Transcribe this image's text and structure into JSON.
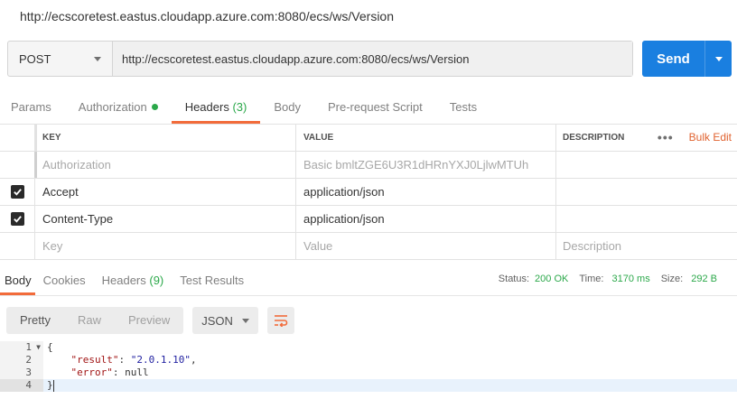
{
  "window": {
    "title": "http://ecscoretest.eastus.cloudapp.azure.com:8080/ecs/ws/Version"
  },
  "request": {
    "method": "POST",
    "url": "http://ecscoretest.eastus.cloudapp.azure.com:8080/ecs/ws/Version",
    "send_label": "Send"
  },
  "request_tabs": {
    "params": "Params",
    "authorization": "Authorization",
    "headers": "Headers",
    "headers_count": "(3)",
    "body": "Body",
    "prerequest": "Pre-request Script",
    "tests": "Tests",
    "active": "Headers"
  },
  "headers_table": {
    "columns": {
      "key": "KEY",
      "value": "VALUE",
      "description": "DESCRIPTION"
    },
    "bulk_edit": "Bulk Edit",
    "rows": [
      {
        "key": "Authorization",
        "value": "Basic bmltZGE6U3R1dHRnYXJ0LjlwMTUh",
        "checked": false
      },
      {
        "key": "Accept",
        "value": "application/json",
        "checked": true
      },
      {
        "key": "Content-Type",
        "value": "application/json",
        "checked": true
      }
    ],
    "placeholders": {
      "key": "Key",
      "value": "Value",
      "description": "Description"
    }
  },
  "response_tabs": {
    "body": "Body",
    "cookies": "Cookies",
    "headers": "Headers",
    "headers_count": "(9)",
    "test_results": "Test Results",
    "active": "Body"
  },
  "response_status": {
    "status_label": "Status:",
    "status_value": "200 OK",
    "time_label": "Time:",
    "time_value": "3170 ms",
    "size_label": "Size:",
    "size_value": "292 B"
  },
  "response_toolbar": {
    "pretty": "Pretty",
    "raw": "Raw",
    "preview": "Preview",
    "format": "JSON",
    "active": "Pretty"
  },
  "response_body": {
    "line_numbers": [
      "1",
      "2",
      "3",
      "4"
    ],
    "open_brace": "{",
    "result_key": "\"result\"",
    "result_value": "\"2.0.1.10\"",
    "error_key": "\"error\"",
    "error_value": "null",
    "close_brace": "}"
  },
  "colors": {
    "accent": "#f26b3a",
    "send": "#1a7fe0",
    "status_ok": "#2ba84a"
  }
}
